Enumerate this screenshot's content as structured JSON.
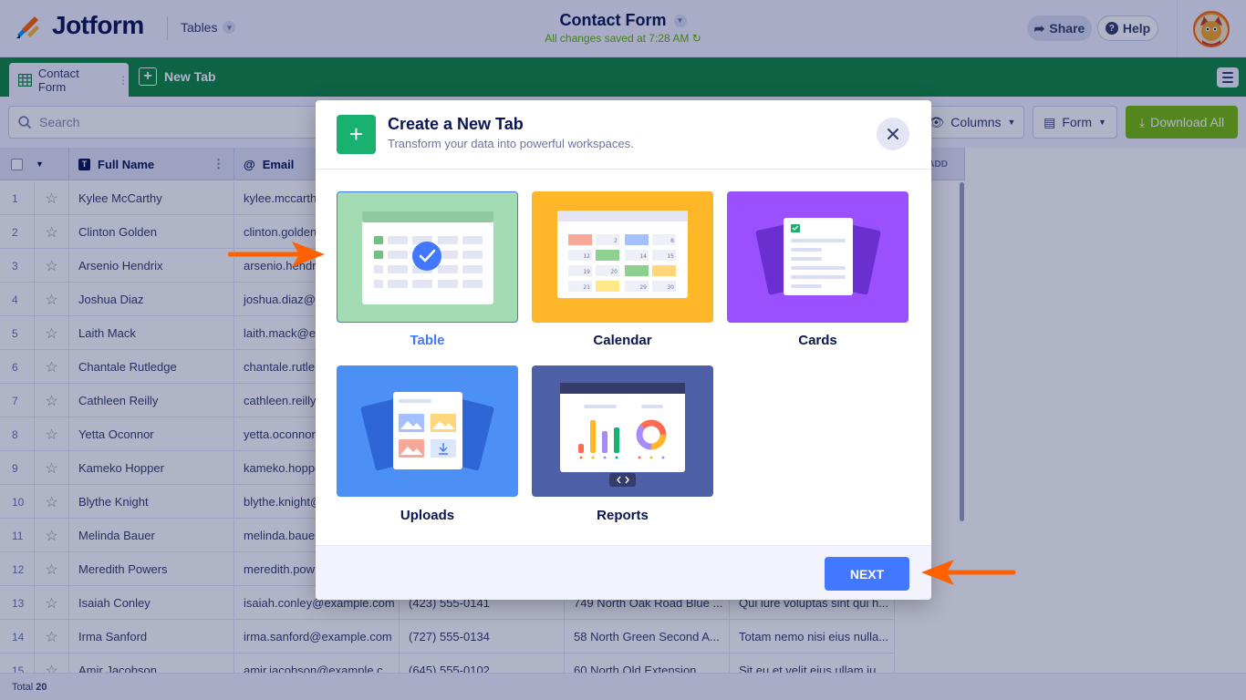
{
  "header": {
    "logo_text": "Jotform",
    "tables_label": "Tables",
    "doc_title": "Contact Form",
    "saved_text": "All changes saved at 7:28 AM",
    "share_label": "Share",
    "help_label": "Help"
  },
  "tabs": {
    "active_label": "Contact Form",
    "new_tab_label": "New Tab"
  },
  "toolbar": {
    "search_placeholder": "Search",
    "columns_label": "Columns",
    "form_label": "Form",
    "download_label": "Download All"
  },
  "grid": {
    "columns": [
      "Full Name",
      "Email"
    ],
    "add_label": "ADD",
    "rows": [
      {
        "idx": "1",
        "name": "Kylee McCarthy",
        "email": "kylee.mccarth",
        "phone": "",
        "address": "",
        "message": ""
      },
      {
        "idx": "2",
        "name": "Clinton Golden",
        "email": "clinton.golden",
        "phone": "",
        "address": "",
        "message": ""
      },
      {
        "idx": "3",
        "name": "Arsenio Hendrix",
        "email": "arsenio.hendri",
        "phone": "",
        "address": "",
        "message": ""
      },
      {
        "idx": "4",
        "name": "Joshua Diaz",
        "email": "joshua.diaz@e",
        "phone": "",
        "address": "",
        "message": ""
      },
      {
        "idx": "5",
        "name": "Laith Mack",
        "email": "laith.mack@ex",
        "phone": "",
        "address": "",
        "message": ""
      },
      {
        "idx": "6",
        "name": "Chantale Rutledge",
        "email": "chantale.rutle",
        "phone": "",
        "address": "",
        "message": ""
      },
      {
        "idx": "7",
        "name": "Cathleen Reilly",
        "email": "cathleen.reilly",
        "phone": "",
        "address": "",
        "message": ""
      },
      {
        "idx": "8",
        "name": "Yetta Oconnor",
        "email": "yetta.oconnor",
        "phone": "",
        "address": "",
        "message": ""
      },
      {
        "idx": "9",
        "name": "Kameko Hopper",
        "email": "kameko.hoppe",
        "phone": "",
        "address": "",
        "message": ""
      },
      {
        "idx": "10",
        "name": "Blythe Knight",
        "email": "blythe.knight@",
        "phone": "",
        "address": "",
        "message": ""
      },
      {
        "idx": "11",
        "name": "Melinda Bauer",
        "email": "melinda.bauer",
        "phone": "",
        "address": "",
        "message": ""
      },
      {
        "idx": "12",
        "name": "Meredith Powers",
        "email": "meredith.pow",
        "phone": "",
        "address": "",
        "message": ""
      },
      {
        "idx": "13",
        "name": "Isaiah Conley",
        "email": "isaiah.conley@example.com",
        "phone": "(423) 555-0141",
        "address": "749 North Oak Road Blue ...",
        "message": "Qui iure voluptas sint qui h..."
      },
      {
        "idx": "14",
        "name": "Irma Sanford",
        "email": "irma.sanford@example.com",
        "phone": "(727) 555-0134",
        "address": "58 North Green Second A...",
        "message": "Totam nemo nisi eius nulla..."
      },
      {
        "idx": "15",
        "name": "Amir Jacobson",
        "email": "amir.jacobson@example.c...",
        "phone": "(645) 555-0102",
        "address": "60 North Old Extension",
        "message": "Sit eu et velit eius ullam ju..."
      }
    ]
  },
  "footer": {
    "total_label": "Total",
    "total_count": "20"
  },
  "modal": {
    "title": "Create a New Tab",
    "subtitle": "Transform your data into powerful workspaces.",
    "options": [
      {
        "label": "Table",
        "color": "#a3dcb3"
      },
      {
        "label": "Calendar",
        "color": "#ffb629"
      },
      {
        "label": "Cards",
        "color": "#9b50ff"
      },
      {
        "label": "Uploads",
        "color": "#4c8ff5"
      },
      {
        "label": "Reports",
        "color": "#4d5fa6"
      }
    ],
    "calendar_numbers": [
      "2",
      "8",
      "12",
      "14",
      "15",
      "19",
      "20",
      "21",
      "29",
      "30"
    ],
    "next_label": "NEXT"
  },
  "colors": {
    "brand_green": "#0e8a3e",
    "accent_blue": "#4277ff",
    "arrow_orange": "#ff6100"
  }
}
